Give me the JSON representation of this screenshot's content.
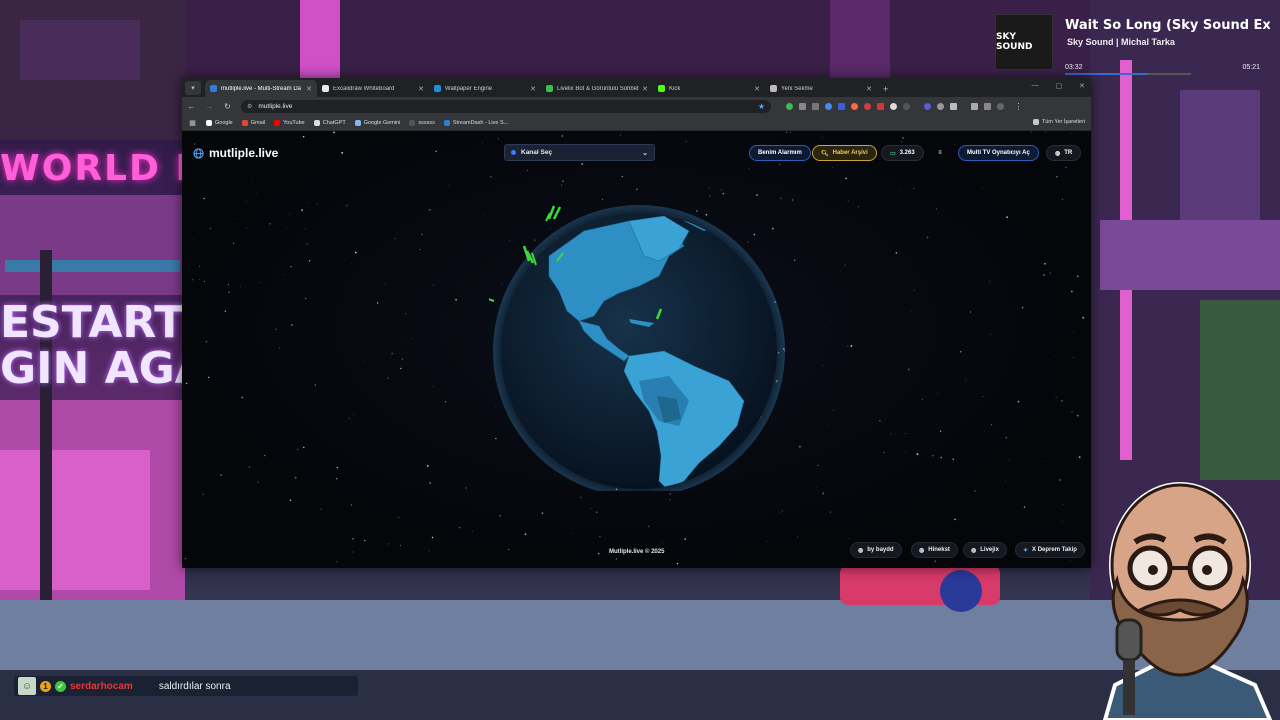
{
  "music": {
    "art_text": "SKY SOUND",
    "title": "Wait So Long (Sky Sound Extended I",
    "artist": "Sky Sound | Michal Tarka",
    "elapsed": "03:32",
    "duration": "05:21",
    "progress": 0.66
  },
  "background": {
    "sign_world": "WORLD L",
    "sign_restart": "ESTART\nGIN AGAIN"
  },
  "browser": {
    "tabs": [
      {
        "label": "mutliple.live - Multi-Stream Da",
        "icon": "mutliple-favicon",
        "color": "#2f7dd8",
        "active": true
      },
      {
        "label": "Excalidraw Whiteboard",
        "icon": "excalidraw-favicon",
        "color": "#e8e8f0",
        "active": false
      },
      {
        "label": "Wallpaper Engine",
        "icon": "wallpaper-engine-favicon",
        "color": "#1e90d8",
        "active": false
      },
      {
        "label": "Livelix Bot & Görüntülü Sohbet",
        "icon": "livelix-favicon",
        "color": "#35c24a",
        "active": false
      },
      {
        "label": "Kick",
        "icon": "kick-favicon",
        "color": "#53fc18",
        "active": false
      },
      {
        "label": "Yeni Sekme",
        "icon": "chrome-favicon",
        "color": "#bbbbbb",
        "active": false
      }
    ],
    "url": "mutliple.live",
    "bookmarks": [
      {
        "label": "Google",
        "color": "#ffffff"
      },
      {
        "label": "Gmail",
        "color": "#ea4335"
      },
      {
        "label": "YouTube",
        "color": "#ff0000"
      },
      {
        "label": "ChatGPT",
        "color": "#dddddd"
      },
      {
        "label": "Google Gemini",
        "color": "#8ab4f8"
      },
      {
        "label": "ssssss",
        "color": "#555555"
      },
      {
        "label": "StreamDash - Live S...",
        "color": "#2f7dd8"
      }
    ],
    "bookmarks_right": "Tüm Yer İşaretleri"
  },
  "site": {
    "logo": "mutliple.live",
    "channel_select": "Kanal Seç",
    "btn_alarm": "Benim Alarmım",
    "btn_archive": "Haber Arşivi",
    "viewer_count": "3.263",
    "btn_multi_tv": "Multi TV Oynatıcıyı Aç",
    "lang": "TR",
    "footer_copy": "Mutliple.live © 2025",
    "footer_links": [
      "by baydd",
      "Hinekst",
      "Livejix",
      "X Deprem Takip"
    ]
  },
  "chat": {
    "username": "serdarhocam",
    "message": "saldırdılar sonra",
    "badge_color": "#e8a020"
  }
}
